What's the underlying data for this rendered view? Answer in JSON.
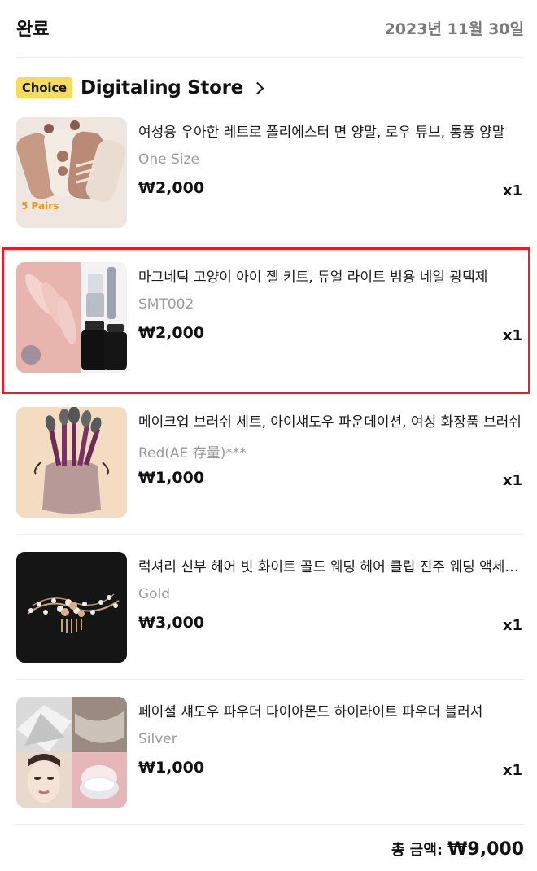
{
  "order": {
    "status": "완료",
    "date": "2023년 11월 30일"
  },
  "store": {
    "badge": "Choice",
    "name": "Digitaling Store"
  },
  "items": [
    {
      "title": "여성용 우아한 레트로 폴리에스터 면 양말, 로우 튜브, 통풍 양말",
      "variant": "One Size",
      "price": "₩2,000",
      "qty": "x1",
      "thumb_label": "5 Pairs",
      "icon": "socks-thumbnail"
    },
    {
      "title": "마그네틱 고양이 아이 젤 키트, 듀얼 라이트 범용 네일 광택제",
      "variant": "SMT002",
      "price": "₩2,000",
      "qty": "x1",
      "icon": "nail-gel-thumbnail"
    },
    {
      "title": "메이크업 브러쉬 세트, 아이섀도우 파운데이션, 여성 화장품 브러쉬",
      "variant": "Red(AE 存量)***",
      "price": "₩1,000",
      "qty": "x1",
      "icon": "makeup-brush-thumbnail"
    },
    {
      "title": "럭셔리 신부 헤어 빗 화이트 골드 웨딩 헤어 클립 진주 웨딩 액세서리",
      "variant": "Gold",
      "price": "₩3,000",
      "qty": "x1",
      "icon": "hair-comb-thumbnail"
    },
    {
      "title": "페이셜 섀도우 파우더 다이아몬드 하이라이트 파우더 블러셔",
      "variant": "Silver",
      "price": "₩1,000",
      "qty": "x1",
      "icon": "highlighter-thumbnail"
    }
  ],
  "total": {
    "label": "총 금액:",
    "value": "₩9,000"
  },
  "colors": {
    "highlight_border": "#e0202a",
    "choice_badge": "#f6dc5a",
    "muted_text": "#9a9a9a"
  }
}
